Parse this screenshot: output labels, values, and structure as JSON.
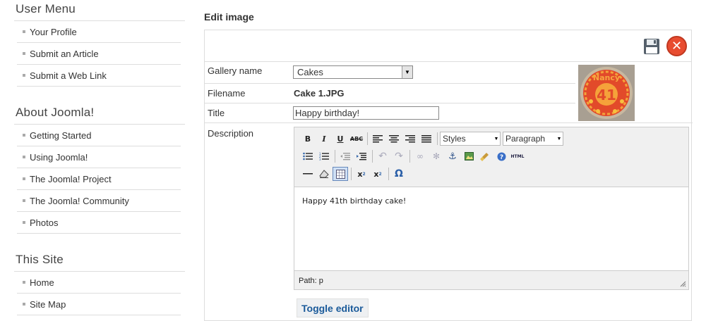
{
  "sidebar": {
    "modules": [
      {
        "title": "User Menu",
        "items": [
          "Your Profile",
          "Submit an Article",
          "Submit a Web Link"
        ]
      },
      {
        "title": "About Joomla!",
        "items": [
          "Getting Started",
          "Using Joomla!",
          "The Joomla! Project",
          "The Joomla! Community",
          "Photos"
        ]
      },
      {
        "title": "This Site",
        "items": [
          "Home",
          "Site Map"
        ]
      }
    ]
  },
  "main": {
    "title": "Edit image",
    "fields": {
      "gallery_label": "Gallery name",
      "gallery_value": "Cakes",
      "filename_label": "Filename",
      "filename_value": "Cake 1.JPG",
      "title_label": "Title",
      "title_value": "Happy birthday!",
      "description_label": "Description"
    },
    "thumbnail": {
      "text_name": "Nancy",
      "text_number": "41"
    },
    "editor": {
      "styles_select": "Styles",
      "format_select": "Paragraph",
      "html_button": "HTML",
      "content": "Happy 41th birthday cake!",
      "path": "Path: p"
    },
    "toggle_label": "Toggle editor"
  },
  "colors": {
    "accent": "#1a5a9a",
    "close": "#e84c30",
    "border": "#dddddd"
  },
  "icons": [
    "save-icon",
    "close-icon",
    "bold-icon",
    "italic-icon",
    "underline-icon",
    "strikethrough-icon",
    "align-left-icon",
    "align-center-icon",
    "align-right-icon",
    "align-justify-icon",
    "bullet-list-icon",
    "numbered-list-icon",
    "outdent-icon",
    "indent-icon",
    "undo-icon",
    "redo-icon",
    "link-icon",
    "unlink-icon",
    "anchor-icon",
    "image-icon",
    "cleanup-icon",
    "help-icon",
    "horizontal-rule-icon",
    "remove-format-icon",
    "visual-aid-icon",
    "subscript-icon",
    "superscript-icon",
    "special-char-icon",
    "resize-icon"
  ]
}
